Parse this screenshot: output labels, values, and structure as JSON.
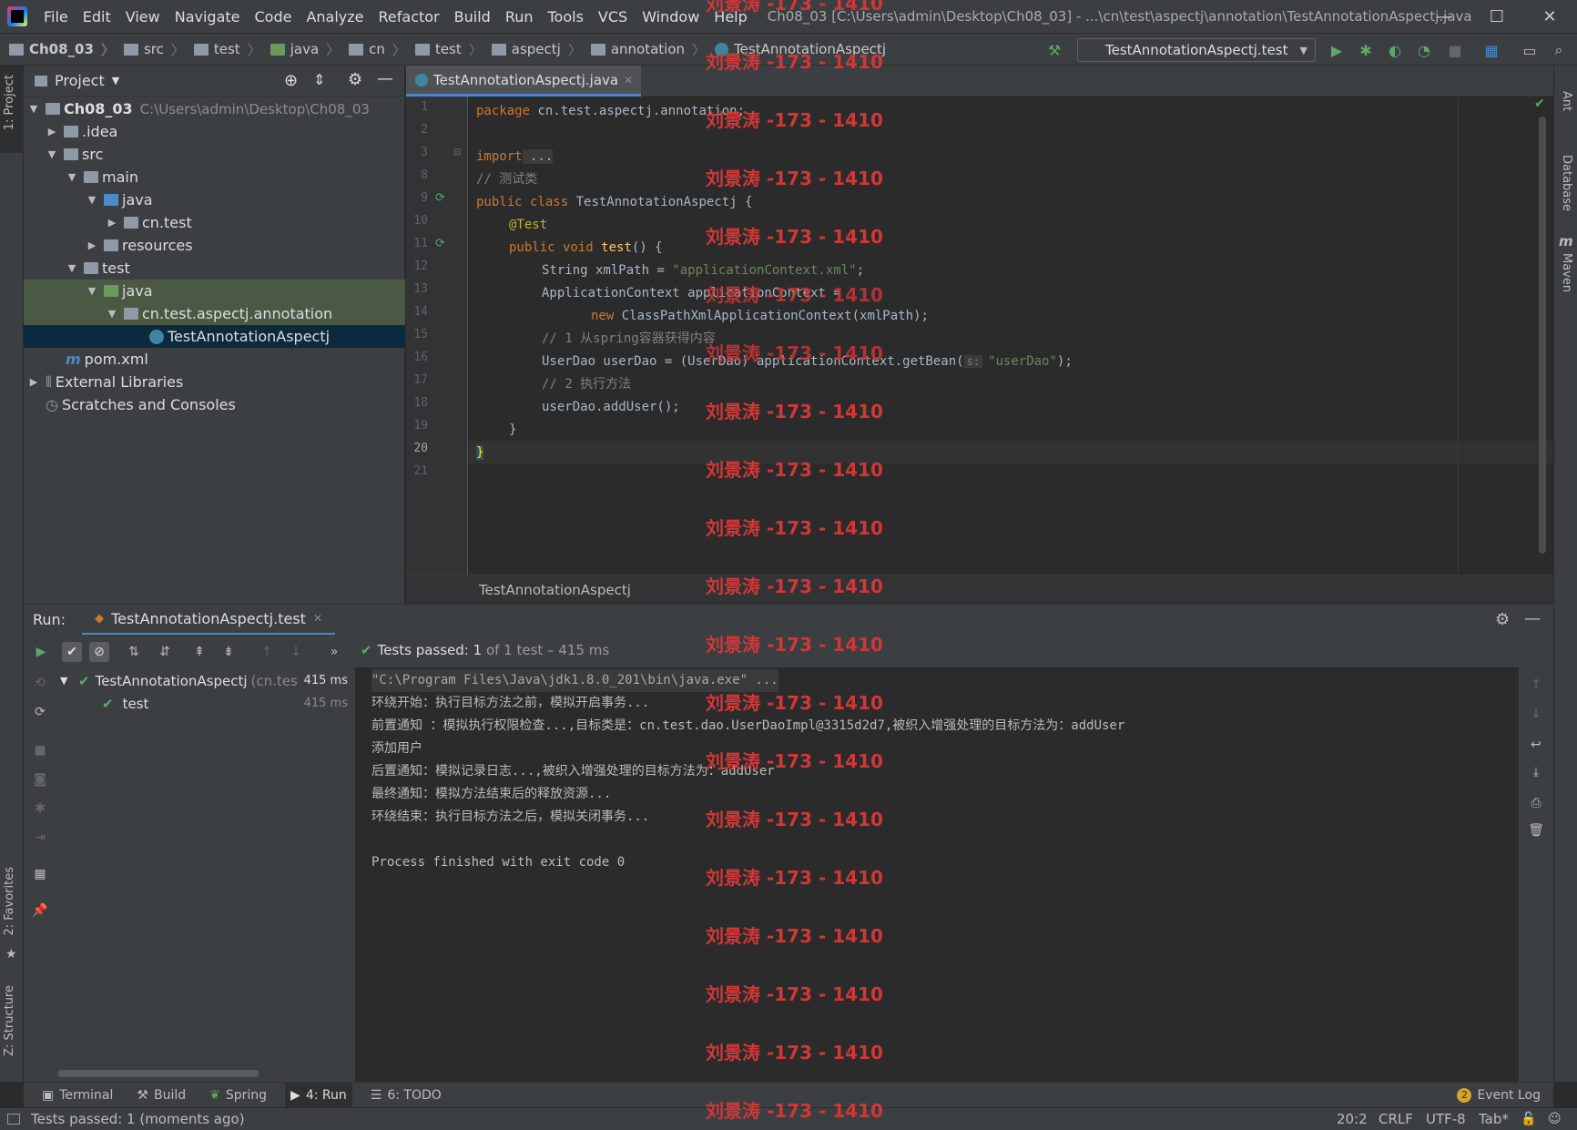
{
  "menubar": {
    "items": [
      "File",
      "Edit",
      "View",
      "Navigate",
      "Code",
      "Analyze",
      "Refactor",
      "Build",
      "Run",
      "Tools",
      "VCS",
      "Window",
      "Help"
    ],
    "window_title": "Ch08_03 [C:\\Users\\admin\\Desktop\\Ch08_03] - ...\\cn\\test\\aspectj\\annotation\\TestAnnotationAspectj.java",
    "minimize": "—",
    "maximize": "☐",
    "close": "✕"
  },
  "navbar": {
    "crumbs": [
      "Ch08_03",
      "src",
      "test",
      "java",
      "cn",
      "test",
      "aspectj",
      "annotation",
      "TestAnnotationAspectj"
    ],
    "run_config": "TestAnnotationAspectj.test"
  },
  "project": {
    "title": "Project",
    "tree": [
      {
        "label": "Ch08_03",
        "path": "C:\\Users\\admin\\Desktop\\Ch08_03"
      },
      {
        "label": ".idea"
      },
      {
        "label": "src"
      },
      {
        "label": "main"
      },
      {
        "label": "java"
      },
      {
        "label": "cn.test"
      },
      {
        "label": "resources"
      },
      {
        "label": "test"
      },
      {
        "label": "java"
      },
      {
        "label": "cn.test.aspectj.annotation"
      },
      {
        "label": "TestAnnotationAspectj"
      },
      {
        "label": "pom.xml"
      },
      {
        "label": "External Libraries"
      },
      {
        "label": "Scratches and Consoles"
      }
    ]
  },
  "editor": {
    "tab_label": "TestAnnotationAspectj.java",
    "line_numbers": [
      "1",
      "2",
      "3",
      "8",
      "9",
      "10",
      "11",
      "12",
      "13",
      "14",
      "15",
      "16",
      "17",
      "18",
      "19",
      "20",
      "21"
    ],
    "breadcrumb": "TestAnnotationAspectj",
    "lines": {
      "l1_kw": "package",
      "l1_rest": " cn.test.aspectj.annotation;",
      "l3_kw": "import",
      "l3_rest": " ...",
      "l8": "// 测试类",
      "l9_kw": "public class",
      "l9_rest": " TestAnnotationAspectj {",
      "l10": "@Test",
      "l11_kw": "public void",
      "l11_fn": "test",
      "l11_rest": "() {",
      "l12_a": "String xmlPath = ",
      "l12_str": "\"applicationContext.xml\"",
      "l12_b": ";",
      "l13": "ApplicationContext applicationContext =",
      "l14_kw": "new",
      "l14_rest": " ClassPathXmlApplicationContext(xmlPath);",
      "l15": "// 1 从spring容器获得内容",
      "l16_a": "UserDao userDao = (UserDao) applicationContext.getBean(",
      "l16_hint": "s:",
      "l16_str": "\"userDao\"",
      "l16_b": ");",
      "l17": "// 2 执行方法",
      "l18": "userDao.addUser();",
      "l19": "}",
      "l20": "}"
    }
  },
  "run": {
    "label": "Run:",
    "tab_label": "TestAnnotationAspectj.test",
    "tests_passed": "Tests passed: 1",
    "tests_summary": " of 1 test – 415 ms",
    "tree_root": "TestAnnotationAspectj",
    "tree_root_pkg": "(cn.tes",
    "tree_root_time": "415 ms",
    "tree_child": "test",
    "tree_child_time": "415 ms",
    "console": [
      "\"C:\\Program Files\\Java\\jdk1.8.0_201\\bin\\java.exe\" ...",
      "环绕开始：执行目标方法之前，模拟开启事务...",
      "前置通知 ：模拟执行权限检查...,目标类是：cn.test.dao.UserDaoImpl@3315d2d7,被织入增强处理的目标方法为：addUser",
      "添加用户",
      "后置通知：模拟记录日志...,被织入增强处理的目标方法为：addUser",
      "最终通知：模拟方法结束后的释放资源...",
      "环绕结束：执行目标方法之后，模拟关闭事务...",
      "",
      "Process finished with exit code 0"
    ]
  },
  "bottom_tabs": {
    "terminal": "Terminal",
    "build": "Build",
    "spring": "Spring",
    "run": "4: Run",
    "todo": "6: TODO",
    "event_log": "Event Log",
    "event_count": "2"
  },
  "status": {
    "message": "Tests passed: 1 (moments ago)",
    "position": "20:2",
    "line_sep": "CRLF",
    "encoding": "UTF-8",
    "indent": "Tab*"
  },
  "side_tools": {
    "project": "1: Project",
    "favorites": "2: Favorites",
    "structure": "Z: Structure",
    "ant": "Ant",
    "database": "Database",
    "maven": "Maven"
  },
  "watermark": "刘景涛 -173 - 1410",
  "colors": {
    "accent": "#4a88c7",
    "success": "#59a869",
    "watermark": "#d23737"
  }
}
